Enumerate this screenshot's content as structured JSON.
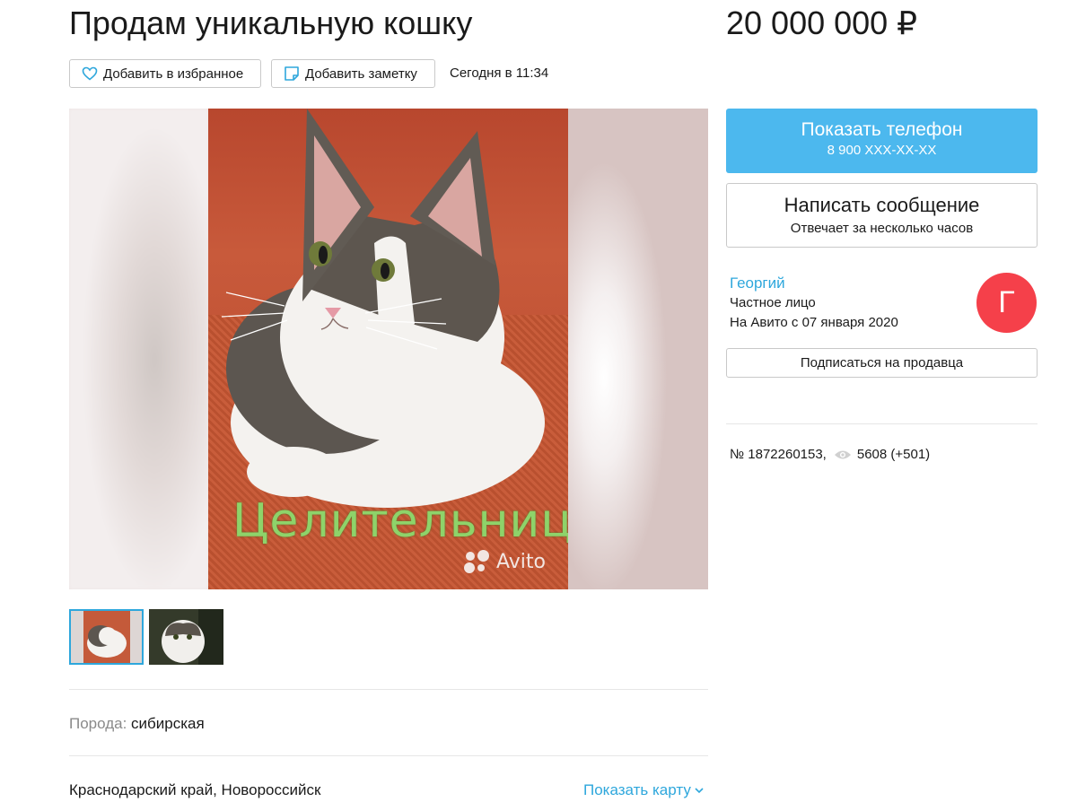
{
  "listing": {
    "title": "Продам уникальную кошку",
    "price": "20 000 000 ₽",
    "posted": "Сегодня в 11:34"
  },
  "actions": {
    "favorite_label": "Добавить в избранное",
    "note_label": "Добавить заметку"
  },
  "gallery": {
    "caption": "Целительница",
    "watermark": "Avito",
    "thumbnails": [
      {
        "selected": true
      },
      {
        "selected": false
      }
    ]
  },
  "params": {
    "breed_label": "Порода:",
    "breed_value": "сибирская"
  },
  "location": {
    "address": "Краснодарский край, Новороссийск",
    "map_link": "Показать карту"
  },
  "contact": {
    "phone_label": "Показать телефон",
    "phone_masked": "8 900 XXX-XX-XX",
    "message_label": "Написать сообщение",
    "message_sub": "Отвечает за несколько часов"
  },
  "seller": {
    "name": "Георгий",
    "type": "Частное лицо",
    "since": "На Авито с 07 января 2020",
    "avatar_letter": "Г",
    "subscribe_label": "Подписаться на продавца"
  },
  "meta": {
    "ad_number": "№ 1872260153,",
    "views": "5608 (+501)"
  },
  "colors": {
    "accent_blue": "#4cb8ee",
    "link_blue": "#2ea7dc",
    "avatar_red": "#f5404a"
  }
}
